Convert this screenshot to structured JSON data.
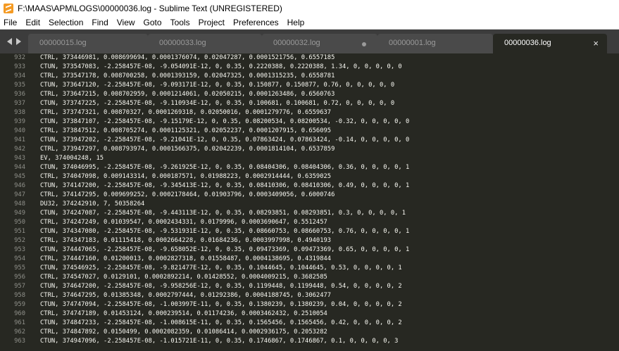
{
  "window": {
    "title": "F:\\MAAS\\APM\\LOGS\\00000036.log - Sublime Text (UNREGISTERED)"
  },
  "menu": [
    "File",
    "Edit",
    "Selection",
    "Find",
    "View",
    "Goto",
    "Tools",
    "Project",
    "Preferences",
    "Help"
  ],
  "tabs": [
    {
      "label": "00000015.log",
      "active": false,
      "dirty": false
    },
    {
      "label": "00000033.log",
      "active": false,
      "dirty": false
    },
    {
      "label": "00000032.log",
      "active": false,
      "dirty": true
    },
    {
      "label": "00000001.log",
      "active": false,
      "dirty": false
    },
    {
      "label": "00000036.log",
      "active": true,
      "dirty": false
    }
  ],
  "tab_close_glyph": "×",
  "lines": [
    {
      "n": "932",
      "text": "CTRL, 373446981, 0.008699694, 0.0001376074, 0.02047287, 0.0001521756, 0.6557185"
    },
    {
      "n": "933",
      "text": "CTUN, 373547083, -2.258457E-08, -9.054091E-12, 0, 0.35, 0.2220388, 0.2220388, 1.34, 0, 0, 0, 0, 0"
    },
    {
      "n": "934",
      "text": "CTRL, 373547178, 0.008700258, 0.0001393159, 0.02047325, 0.0001315235, 0.6558781"
    },
    {
      "n": "935",
      "text": "CTUN, 373647120, -2.258457E-08, -9.093171E-12, 0, 0.35, 0.150877, 0.150877, 0.76, 0, 0, 0, 0, 0"
    },
    {
      "n": "936",
      "text": "CTRL, 373647215, 0.008702959, 0.0001214061, 0.02050215, 0.0001263486, 0.6560763"
    },
    {
      "n": "937",
      "text": "CTUN, 373747225, -2.258457E-08, -9.110934E-12, 0, 0.35, 0.100681, 0.100681, 0.72, 0, 0, 0, 0, 0"
    },
    {
      "n": "938",
      "text": "CTRL, 373747321, 0.00870327, 0.0001269318, 0.02050016, 0.0001279776, 0.6559637"
    },
    {
      "n": "939",
      "text": "CTUN, 373847107, -2.258457E-08, -9.15179E-12, 0, 0.35, 0.08200534, 0.08200534, -0.32, 0, 0, 0, 0, 0"
    },
    {
      "n": "940",
      "text": "CTRL, 373847512, 0.008705274, 0.0001125321, 0.02052237, 0.0001207915, 0.656095"
    },
    {
      "n": "941",
      "text": "CTUN, 373947202, -2.258457E-08, -9.21041E-12, 0, 0.35, 0.07863424, 0.07863424, -0.14, 0, 0, 0, 0, 0"
    },
    {
      "n": "942",
      "text": "CTRL, 373947297, 0.008793974, 0.0001566375, 0.02042239, 0.0001814104, 0.6537859"
    },
    {
      "n": "943",
      "text": "EV, 374004248, 15"
    },
    {
      "n": "944",
      "text": "CTUN, 374046995, -2.258457E-08, -9.261925E-12, 0, 0.35, 0.08404306, 0.08404306, 0.36, 0, 0, 0, 0, 1"
    },
    {
      "n": "945",
      "text": "CTRL, 374047098, 0.009143314, 0.000187571, 0.01988223, 0.0002914444, 0.6359025"
    },
    {
      "n": "946",
      "text": "CTUN, 374147200, -2.258457E-08, -9.345413E-12, 0, 0.35, 0.08410306, 0.08410306, 0.49, 0, 0, 0, 0, 1"
    },
    {
      "n": "947",
      "text": "CTRL, 374147295, 0.009699252, 0.0002178464, 0.01903796, 0.0003409056, 0.6000746"
    },
    {
      "n": "948",
      "text": "DU32, 374242910, 7, 50358264"
    },
    {
      "n": "949",
      "text": "CTUN, 374247087, -2.258457E-08, -9.443113E-12, 0, 0.35, 0.08293851, 0.08293851, 0.3, 0, 0, 0, 0, 1"
    },
    {
      "n": "950",
      "text": "CTRL, 374247249, 0.01039547, 0.0002434331, 0.0179996, 0.0003690647, 0.5512457"
    },
    {
      "n": "951",
      "text": "CTUN, 374347080, -2.258457E-08, -9.531931E-12, 0, 0.35, 0.08660753, 0.08660753, 0.76, 0, 0, 0, 0, 1"
    },
    {
      "n": "952",
      "text": "CTRL, 374347183, 0.01115418, 0.0002664228, 0.01684236, 0.0003997998, 0.4940193"
    },
    {
      "n": "953",
      "text": "CTUN, 374447065, -2.258457E-08, -9.658052E-12, 0, 0.35, 0.09473369, 0.09473369, 0.65, 0, 0, 0, 0, 1"
    },
    {
      "n": "954",
      "text": "CTRL, 374447160, 0.01200013, 0.0002827318, 0.01558487, 0.0004138695, 0.4319844"
    },
    {
      "n": "955",
      "text": "CTUN, 374546925, -2.258457E-08, -9.821477E-12, 0, 0.35, 0.1044645, 0.1044645, 0.53, 0, 0, 0, 0, 1"
    },
    {
      "n": "956",
      "text": "CTRL, 374547027, 0.0129101, 0.0002892214, 0.01428552, 0.0004009215, 0.3682585"
    },
    {
      "n": "957",
      "text": "CTUN, 374647200, -2.258457E-08, -9.958256E-12, 0, 0.35, 0.1199448, 0.1199448, 0.54, 0, 0, 0, 0, 2"
    },
    {
      "n": "958",
      "text": "CTRL, 374647295, 0.01385348, 0.0002797444, 0.01292386, 0.0004188745, 0.3062477"
    },
    {
      "n": "959",
      "text": "CTUN, 374747094, -2.258457E-08, -1.003997E-11, 0, 0.35, 0.1380239, 0.1380239, 0.04, 0, 0, 0, 0, 2"
    },
    {
      "n": "960",
      "text": "CTRL, 374747189, 0.01453124, 0.000239514, 0.01174236, 0.0003462432, 0.2510054"
    },
    {
      "n": "961",
      "text": "CTUN, 374847233, -2.258457E-08, -1.008615E-11, 0, 0.35, 0.1565456, 0.1565456, 0.42, 0, 0, 0, 0, 2"
    },
    {
      "n": "962",
      "text": "CTRL, 374847892, 0.0150499, 0.0002082359, 0.01086414, 0.0002936175, 0.2053282"
    },
    {
      "n": "963",
      "text": "CTUN, 374947096, -2.258457E-08, -1.015721E-11, 0, 0.35, 0.1746867, 0.1746867, 0.1, 0, 0, 0, 0, 3"
    }
  ]
}
